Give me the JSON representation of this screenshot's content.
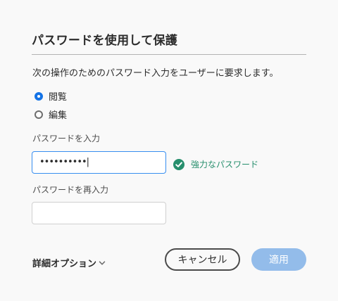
{
  "dialog": {
    "title": "パスワードを使用して保護",
    "description": "次の操作のためのパスワード入力をユーザーに要求します。"
  },
  "permissions": {
    "options": [
      {
        "label": "閲覧",
        "selected": true
      },
      {
        "label": "編集",
        "selected": false
      }
    ]
  },
  "password": {
    "label": "パスワードを入力",
    "value": "••••••••••|",
    "strength_text": "強力なパスワード",
    "strength_icon": "check-circle-icon",
    "strength_color": "#268e6c"
  },
  "confirm_password": {
    "label": "パスワードを再入力",
    "value": ""
  },
  "advanced": {
    "label": "詳細オプション",
    "icon": "chevron-down-icon"
  },
  "buttons": {
    "cancel": "キャンセル",
    "apply": "適用",
    "apply_color": "#93bcea",
    "accent": "#1473e6"
  }
}
